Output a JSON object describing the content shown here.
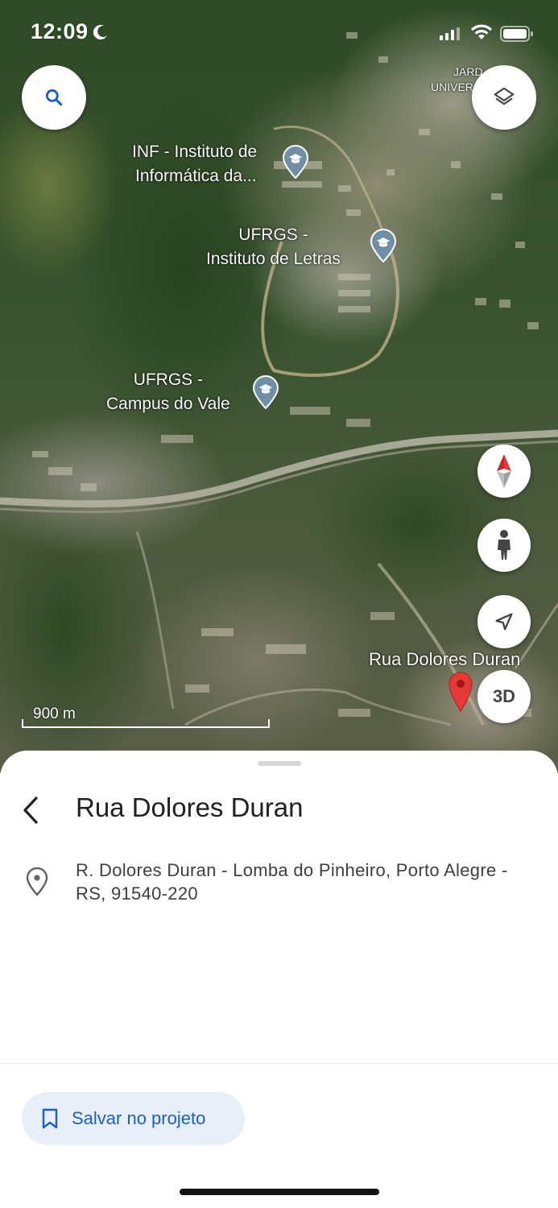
{
  "status_bar": {
    "time": "12:09"
  },
  "map": {
    "labels": {
      "jardim_line1": "JARD",
      "jardim_line2": "UNIVER",
      "inf_line1": "INF - Instituto de",
      "inf_line2": "Informática da...",
      "letras_line1": "UFRGS -",
      "letras_line2": "Instituto de Letras",
      "vale_line1": "UFRGS -",
      "vale_line2": "Campus do Vale",
      "rua": "Rua Dolores Duran"
    },
    "scale_label": "900 m",
    "controls": {
      "three_d_label": "3D"
    },
    "icons": [
      "search-icon",
      "layers-icon",
      "compass-icon",
      "person-icon",
      "navigation-arrow-icon"
    ]
  },
  "sheet": {
    "title": "Rua Dolores Duran",
    "address": "R. Dolores Duran - Lomba do Pinheiro, Porto Alegre - RS, 91540-220",
    "save_label": "Salvar no projeto"
  },
  "colors": {
    "accent": "#1a5fc7",
    "save_button_bg": "#e8eff9",
    "pin_red": "#e53935",
    "poi_pin": "#6f8fa6"
  }
}
